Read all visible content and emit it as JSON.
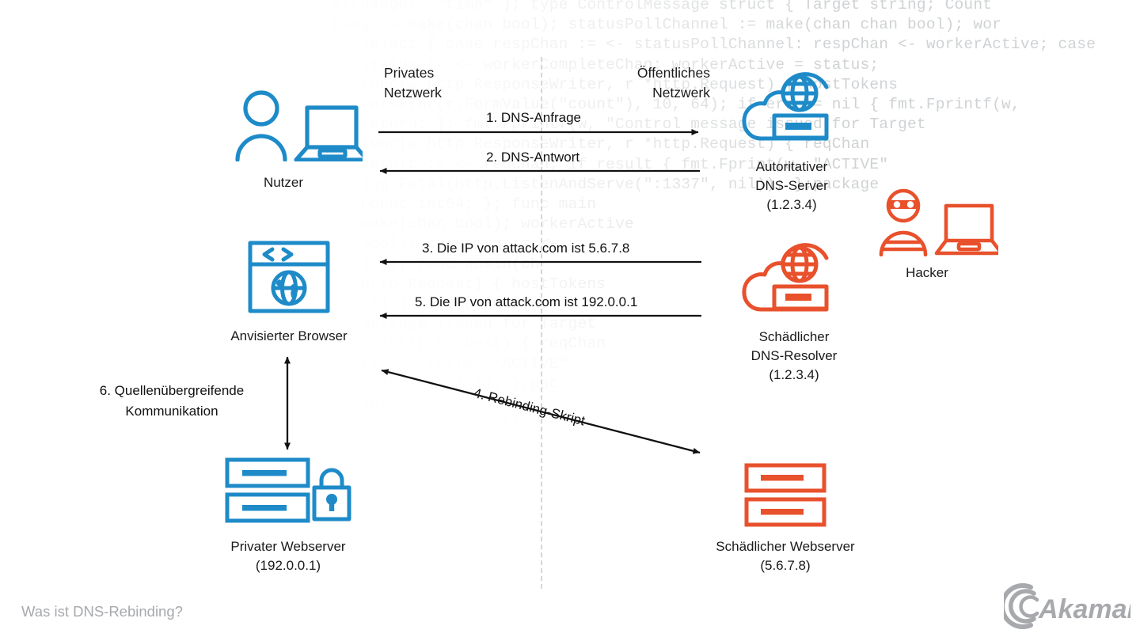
{
  "zones": {
    "left_line1": "Privates",
    "left_line2": "Netzwerk",
    "right_line1": "Öffentliches",
    "right_line2": "Netzwerk"
  },
  "nodes": {
    "user": {
      "label": "Nutzer",
      "icon": "user-laptop-icon",
      "color": "#1e8bc8"
    },
    "browser": {
      "label": "Anvisierter Browser",
      "icon": "browser-globe-icon",
      "color": "#1e8bc8"
    },
    "private_server": {
      "label": "Privater Webserver",
      "sublabel": "(192.0.0.1)",
      "icon": "server-lock-icon",
      "color": "#1e8bc8"
    },
    "authoritative_dns": {
      "label_line1": "Autoritativer",
      "label_line2": "DNS-Server",
      "sublabel": "(1.2.3.4)",
      "icon": "cloud-dns-icon",
      "color": "#1e8bc8"
    },
    "malicious_resolver": {
      "label_line1": "Schädlicher",
      "label_line2": "DNS-Resolver",
      "sublabel": "(1.2.3.4)",
      "icon": "cloud-dns-icon",
      "color": "#e8512c"
    },
    "hacker": {
      "label": "Hacker",
      "icon": "hacker-laptop-icon",
      "color": "#e8512c"
    },
    "malicious_server": {
      "label": "Schädlicher Webserver",
      "sublabel": "(5.6.7.8)",
      "icon": "server-icon",
      "color": "#e8512c"
    }
  },
  "flows": [
    {
      "id": 1,
      "label": "1. DNS-Anfrage",
      "direction": "right"
    },
    {
      "id": 2,
      "label": "2. DNS-Antwort",
      "direction": "left"
    },
    {
      "id": 3,
      "label": "3. Die IP von attack.com ist 5.6.7.8",
      "direction": "left"
    },
    {
      "id": 5,
      "label": "5. Die IP von attack.com ist 192.0.0.1",
      "direction": "left"
    },
    {
      "id": 4,
      "label": "4. Rebinding-Skript",
      "direction": "both-diagonal"
    },
    {
      "id": 6,
      "label_line1": "6. Quellenübergreifende",
      "label_line2": "Kommunikation",
      "direction": "both-vertical"
    }
  ],
  "footer": {
    "caption": "Was ist DNS-Rebinding?",
    "logo_text": "Akamai"
  },
  "background_code": {
    "lines": [
      "atchange(  \"time\" ); type ControlMessage struct { Target string; Count",
      "hang := make(chan bool); statusPollChannel := make(chan chan bool); wor",
      "   select { case respChan := <- statusPollChannel: respChan <- workerActive; case",
      "   status := <- workerCompleteChan: workerActive = status;",
      "   func(w http.ResponseWriter, r *http.Request) { hostTokens",
      "   ParseInt(r.FormValue(\"count\"), 10, 64); if err != nil { fmt.Fprintf(w,",
      "   return; }; fmt.Fprintf(w, \"Control message issued for Target",
      "   func(w http.ResponseWriter, r *http.Request) { reqChan",
      "   result := <- reqChan; if result { fmt.Fprint(w, \"ACTIVE\"",
      "   log.Fatal(http.ListenAndServe(\":1337\", nil)); };package",
      "   Count int64; }; func main",
      "   make(chan bool); workerActive",
      "   bool); case msg := <-",
      "   ) }); func admin(ch",
      "   http.Request) { hostTokens",
      "   nil { fmt.Fprintf(w,",
      "   message issued for Target",
      "   r *http.Request) { reqChan",
      "   fmt.Fprint(w, \"ACTIVE\"",
      "   \":1337\", nil)); };pac",
      "   int64; ); func mai",
      "   bool); workerActi"
    ]
  },
  "colors": {
    "blue": "#1e8bc8",
    "orange": "#e8512c",
    "arrow": "#111111",
    "divider": "#d4d6d8",
    "code": "#cfd2d4",
    "footer_text": "#a7a9ac"
  }
}
